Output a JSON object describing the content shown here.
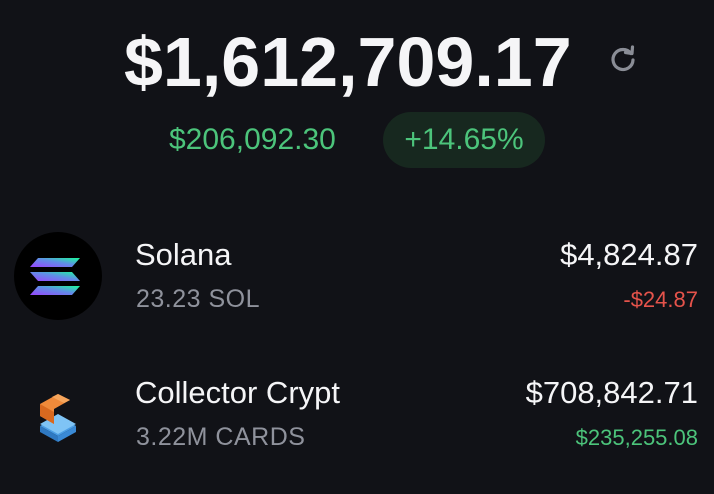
{
  "portfolio": {
    "total_balance": "$1,612,709.17",
    "change_amount": "$206,092.30",
    "change_percent": "+14.65%",
    "refresh_icon": "refresh-icon"
  },
  "assets": [
    {
      "name": "Solana",
      "amount": "23.23 SOL",
      "value": "$4,824.87",
      "change": "-$24.87",
      "change_direction": "negative",
      "icon": "solana-logo-icon"
    },
    {
      "name": "Collector Crypt",
      "amount": "3.22M CARDS",
      "value": "$708,842.71",
      "change": "$235,255.08",
      "change_direction": "positive",
      "icon": "collector-crypt-logo-icon"
    }
  ],
  "colors": {
    "background": "#111217",
    "positive": "#4cc47b",
    "negative": "#e5534b",
    "muted": "#8f929c",
    "pill_background": "#17281f"
  }
}
